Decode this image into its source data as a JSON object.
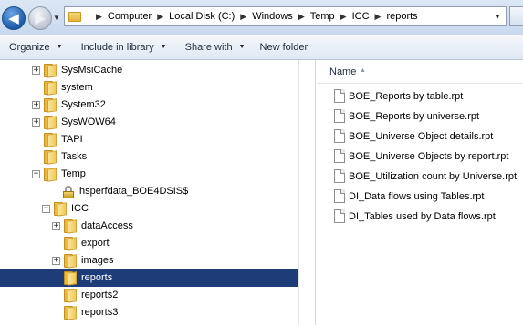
{
  "address": {
    "crumbs": [
      "Computer",
      "Local Disk (C:)",
      "Windows",
      "Temp",
      "ICC",
      "reports"
    ]
  },
  "toolbar": {
    "organize": "Organize",
    "include_in_library": "Include in library",
    "share_with": "Share with",
    "new_folder": "New folder"
  },
  "tree": {
    "items": [
      {
        "label": "SysMsiCache",
        "expander": "+",
        "indent": 0
      },
      {
        "label": "system",
        "expander": "",
        "indent": 0
      },
      {
        "label": "System32",
        "expander": "+",
        "indent": 0
      },
      {
        "label": "SysWOW64",
        "expander": "+",
        "indent": 0
      },
      {
        "label": "TAPI",
        "expander": "",
        "indent": 0
      },
      {
        "label": "Tasks",
        "expander": "",
        "indent": 0
      },
      {
        "label": "Temp",
        "expander": "−",
        "indent": 0
      },
      {
        "label": "hsperfdata_BOE4DSIS$",
        "expander": "",
        "indent": 1,
        "locked": true
      },
      {
        "label": "ICC",
        "expander": "−",
        "indent": 1
      },
      {
        "label": "dataAccess",
        "expander": "+",
        "indent": 2
      },
      {
        "label": "export",
        "expander": "",
        "indent": 2
      },
      {
        "label": "images",
        "expander": "+",
        "indent": 2
      },
      {
        "label": "reports",
        "expander": "",
        "indent": 2,
        "selected": true
      },
      {
        "label": "reports2",
        "expander": "",
        "indent": 2
      },
      {
        "label": "reports3",
        "expander": "",
        "indent": 2
      }
    ]
  },
  "content": {
    "column_name": "Name",
    "files": [
      "BOE_Reports by table.rpt",
      "BOE_Reports by universe.rpt",
      "BOE_Universe Object details.rpt",
      "BOE_Universe Objects by report.rpt",
      "BOE_Utilization count by Universe.rpt",
      "DI_Data flows using Tables.rpt",
      "DI_Tables used by Data flows.rpt"
    ]
  },
  "colors": {
    "selection": "#1e3c78",
    "address_bg": "#d3e1f2",
    "folder": "#f0c85a"
  }
}
